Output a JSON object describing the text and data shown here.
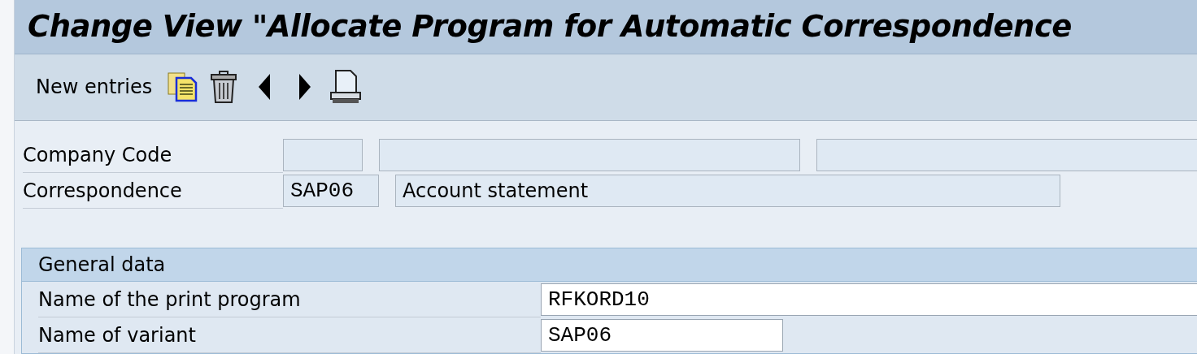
{
  "window": {
    "title": "Change View \"Allocate Program for Automatic Correspondence"
  },
  "toolbar": {
    "items": [
      {
        "kind": "text",
        "label": "New entries"
      },
      {
        "kind": "copy"
      },
      {
        "kind": "delete"
      },
      {
        "kind": "previous"
      },
      {
        "kind": "next"
      },
      {
        "kind": "print"
      }
    ]
  },
  "header_fields": [
    {
      "label": "Company Code",
      "fields": [
        {
          "kind": "code",
          "editable": false
        },
        {
          "kind": "text",
          "editable": false
        },
        {
          "kind": "text",
          "editable": false
        }
      ]
    },
    {
      "label": "Correspondence",
      "fields": [
        {
          "kind": "code",
          "editable": false,
          "value": "SAP06"
        },
        {
          "kind": "text",
          "editable": false,
          "value": "Account statement"
        }
      ]
    }
  ],
  "group": {
    "title": "General data",
    "rows": [
      {
        "label": "Name of the print program",
        "field": {
          "kind": "code",
          "editable": true,
          "value": "RFKORD10"
        }
      },
      {
        "label": "Name of variant",
        "field": {
          "kind": "code",
          "editable": true,
          "value": "SAP06"
        }
      }
    ]
  }
}
